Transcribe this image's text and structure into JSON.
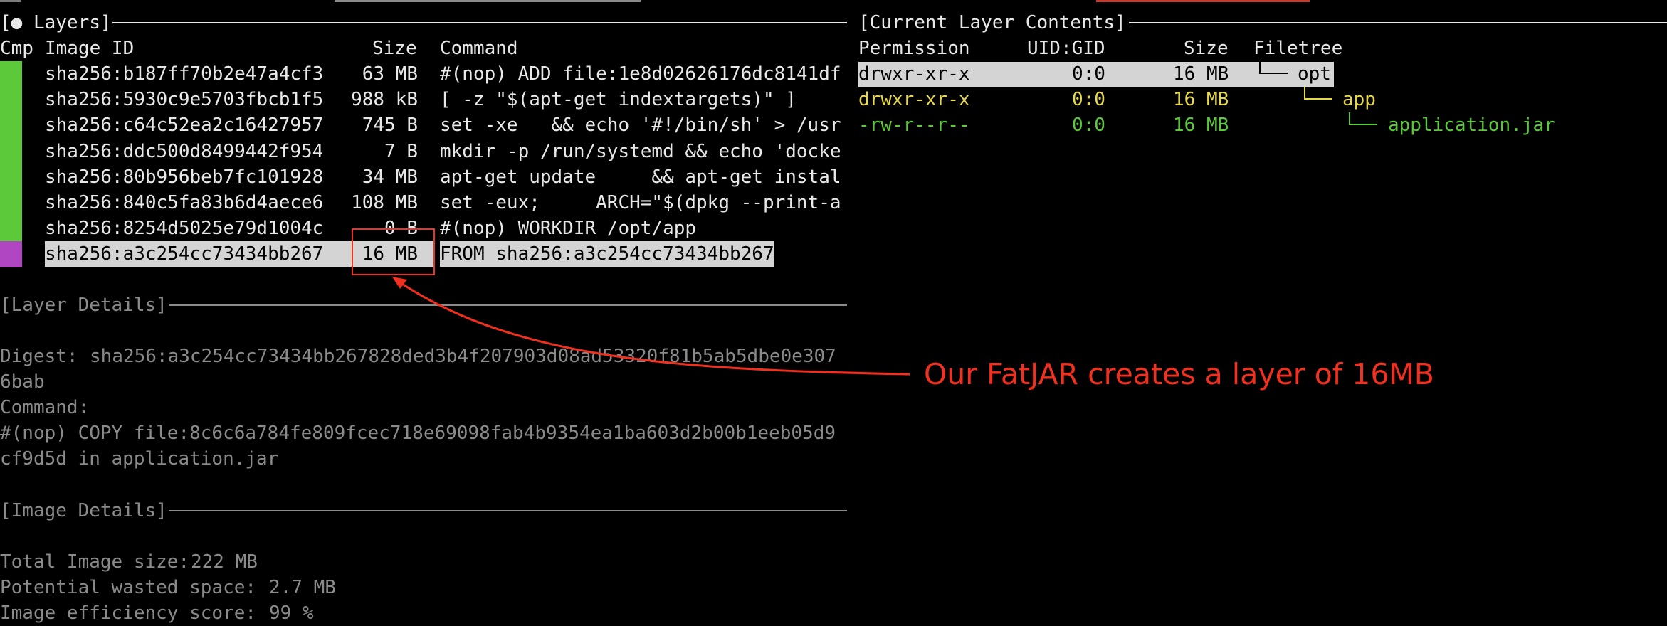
{
  "layers_panel": {
    "title": "[● Layers]",
    "headers": {
      "cmp": "Cmp",
      "image_id": "Image ID",
      "size": "Size",
      "command": "Command"
    },
    "rows": [
      {
        "image_id": "sha256:b187ff70b2e47a4cf3",
        "size": "63 MB",
        "command": "#(nop) ADD file:1e8d02626176dc8141df"
      },
      {
        "image_id": "sha256:5930c9e5703fbcb1f5",
        "size": "988 kB",
        "command": "[ -z \"$(apt-get indextargets)\" ]"
      },
      {
        "image_id": "sha256:c64c52ea2c16427957",
        "size": "745 B",
        "command": "set -xe   && echo '#!/bin/sh' > /usr"
      },
      {
        "image_id": "sha256:ddc500d8499442f954",
        "size": "7 B",
        "command": "mkdir -p /run/systemd && echo 'docke"
      },
      {
        "image_id": "sha256:80b956beb7fc101928",
        "size": "34 MB",
        "command": "apt-get update     && apt-get instal"
      },
      {
        "image_id": "sha256:840c5fa83b6d4aece6",
        "size": "108 MB",
        "command": "set -eux;     ARCH=\"$(dpkg --print-a"
      },
      {
        "image_id": "sha256:8254d5025e79d1004c",
        "size": "0 B",
        "command": "#(nop) WORKDIR /opt/app"
      },
      {
        "image_id": "sha256:a3c254cc73434bb267",
        "size": "16 MB",
        "command": "FROM sha256:a3c254cc73434bb267"
      }
    ],
    "cmp_colors": [
      "#5cc93b",
      "#5cc93b",
      "#5cc93b",
      "#5cc93b",
      "#5cc93b",
      "#5cc93b",
      "#5cc93b",
      "#b146c2"
    ]
  },
  "layer_details": {
    "title": "[Layer Details]",
    "digest_label": "Digest:",
    "digest_line1": "sha256:a3c254cc73434bb267828ded3b4f207903d08ad53320f81b5ab5dbe0e307",
    "digest_line2": "6bab",
    "command_label": "Command:",
    "command_line1": "#(nop) COPY file:8c6c6a784fe809fcec718e69098fab4b9354ea1ba603d2b00b1eeb05d9",
    "command_line2": "cf9d5d in application.jar"
  },
  "image_details": {
    "title": "[Image Details]",
    "total_size_label": "Total Image size:",
    "total_size_value": "222 MB",
    "wasted_label": "Potential wasted space:",
    "wasted_value": "2.7 MB",
    "efficiency_label": "Image efficiency score:",
    "efficiency_value": "99 %"
  },
  "contents_panel": {
    "title": "[Current Layer Contents]",
    "headers": {
      "permission": "Permission",
      "uid_gid": "UID:GID",
      "size": "Size",
      "filetree": "Filetree"
    },
    "rows": [
      {
        "permission": "drwxr-xr-x",
        "uid_gid": "0:0",
        "size": "16 MB",
        "name": "opt"
      },
      {
        "permission": "drwxr-xr-x",
        "uid_gid": "0:0",
        "size": "16 MB",
        "name": "app"
      },
      {
        "permission": "-rw-r--r--",
        "uid_gid": "0:0",
        "size": "16 MB",
        "name": "application.jar"
      }
    ]
  },
  "annotation": {
    "text": "Our FatJAR creates a layer of 16MB",
    "color": "#f2301f"
  }
}
